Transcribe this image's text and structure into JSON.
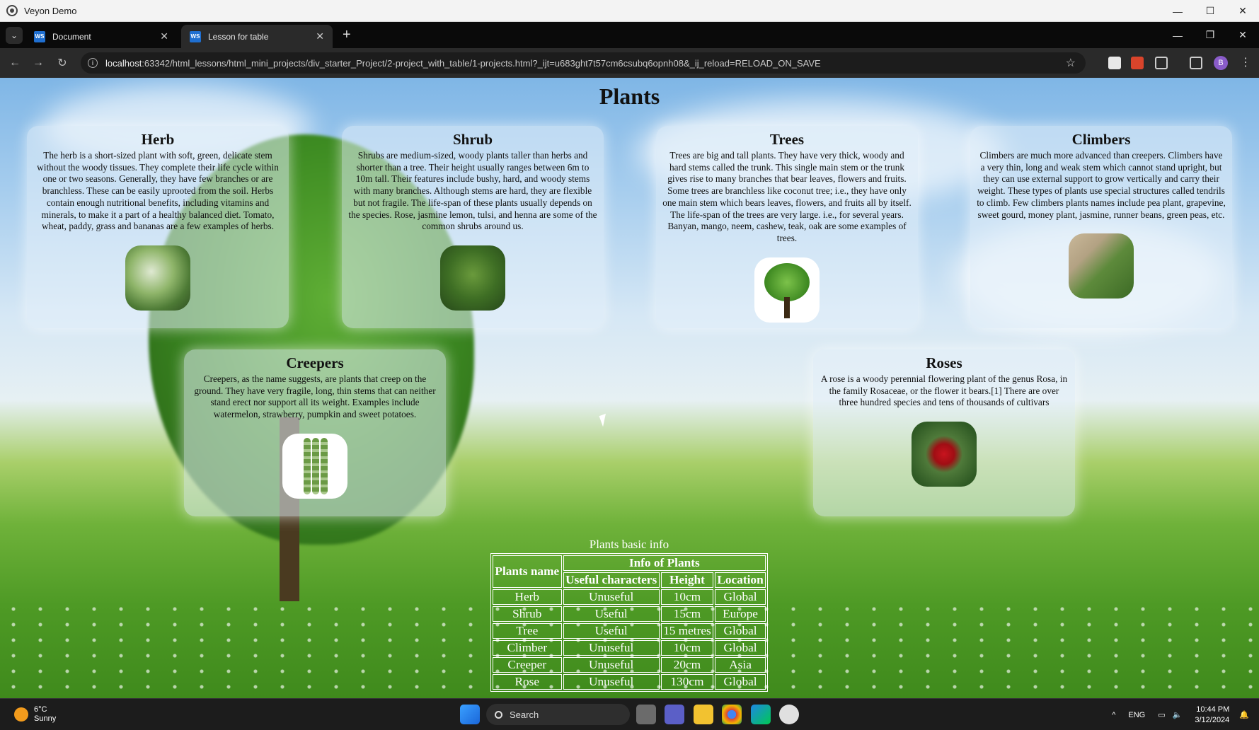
{
  "window": {
    "title": "Veyon Demo",
    "minimize": "—",
    "maximize": "☐",
    "close": "✕"
  },
  "browser": {
    "tabs": [
      {
        "label": "Document",
        "favicon": "WS",
        "close": "✕"
      },
      {
        "label": "Lesson for table",
        "favicon": "WS",
        "close": "✕"
      }
    ],
    "new_tab": "+",
    "url_host": "localhost",
    "url_rest": ":63342/html_lessons/html_mini_projects/div_starter_Project/2-project_with_table/1-projects.html?_ijt=u683ght7t57cm6csubq6opnh08&_ij_reload=RELOAD_ON_SAVE",
    "profile_initial": "B"
  },
  "page": {
    "title": "Plants",
    "cards": {
      "herb": {
        "title": "Herb",
        "text": "The herb is a short-sized plant with soft, green, delicate stem without the woody tissues. They complete their life cycle within one or two seasons. Generally, they have few branches or are branchless. These can be easily uprooted from the soil. Herbs contain enough nutritional benefits, including vitamins and minerals, to make it a part of a healthy balanced diet. Tomato, wheat, paddy, grass and bananas are a few examples of herbs."
      },
      "shrub": {
        "title": "Shrub",
        "text": "Shrubs are medium-sized, woody plants taller than herbs and shorter than a tree. Their height usually ranges between 6m to 10m tall. Their features include bushy, hard, and woody stems with many branches. Although stems are hard, they are flexible but not fragile. The life-span of these plants usually depends on the species. Rose, jasmine lemon, tulsi, and henna are some of the common shrubs around us."
      },
      "trees": {
        "title": "Trees",
        "text": "Trees are big and tall plants. They have very thick, woody and hard stems called the trunk. This single main stem or the trunk gives rise to many branches that bear leaves, flowers and fruits. Some trees are branchless like coconut tree; i.e., they have only one main stem which bears leaves, flowers, and fruits all by itself. The life-span of the trees are very large. i.e., for several years. Banyan, mango, neem, cashew, teak, oak are some examples of trees."
      },
      "climbers": {
        "title": "Climbers",
        "text": "Climbers are much more advanced than creepers. Climbers have a very thin, long and weak stem which cannot stand upright, but they can use external support to grow vertically and carry their weight. These types of plants use special structures called tendrils to climb. Few climbers plants names include pea plant, grapevine, sweet gourd, money plant, jasmine, runner beans, green peas, etc."
      },
      "creepers": {
        "title": "Creepers",
        "text": "Creepers, as the name suggests, are plants that creep on the ground. They have very fragile, long, thin stems that can neither stand erect nor support all its weight. Examples include watermelon, strawberry, pumpkin and sweet potatoes."
      },
      "roses": {
        "title": "Roses",
        "text": "A rose is a woody perennial flowering plant of the genus Rosa, in the family Rosaceae, or the flower it bears.[1] There are over three hundred species and tens of thousands of cultivars"
      }
    },
    "table": {
      "caption": "Plants basic info",
      "col_plants_name": "Plants name",
      "group_header": "Info of Plants",
      "headers": [
        "Useful characters",
        "Height",
        "Location"
      ],
      "rows": [
        [
          "Herb",
          "Unuseful",
          "10cm",
          "Global"
        ],
        [
          "Shrub",
          "Useful",
          "15cm",
          "Europe"
        ],
        [
          "Tree",
          "Useful",
          "15 metres",
          "Global"
        ],
        [
          "Climber",
          "Unuseful",
          "10cm",
          "Global"
        ],
        [
          "Creeper",
          "Unuseful",
          "20cm",
          "Asia"
        ],
        [
          "Rose",
          "Unuseful",
          "130cm",
          "Global"
        ]
      ]
    }
  },
  "taskbar": {
    "weather_temp": "6°C",
    "weather_desc": "Sunny",
    "search_label": "Search",
    "tray_chevron": "^",
    "language": "ENG",
    "time": "10:44 PM",
    "date": "3/12/2024"
  }
}
